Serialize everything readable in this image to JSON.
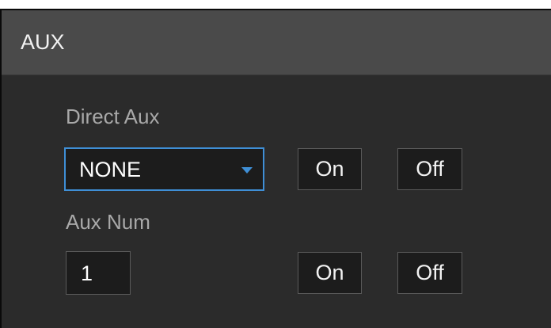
{
  "header": {
    "title": "AUX"
  },
  "direct_aux": {
    "label": "Direct Aux",
    "select_value": "NONE",
    "on_label": "On",
    "off_label": "Off"
  },
  "aux_num": {
    "label": "Aux Num",
    "value": "1",
    "on_label": "On",
    "off_label": "Off"
  },
  "colors": {
    "panel_bg": "#2b2b2b",
    "title_bar_bg": "#4a4a4a",
    "focus_border": "#3f8fd6",
    "label_text": "#a9a9a9"
  },
  "icons": {
    "select_caret": "chevron-down-icon"
  }
}
